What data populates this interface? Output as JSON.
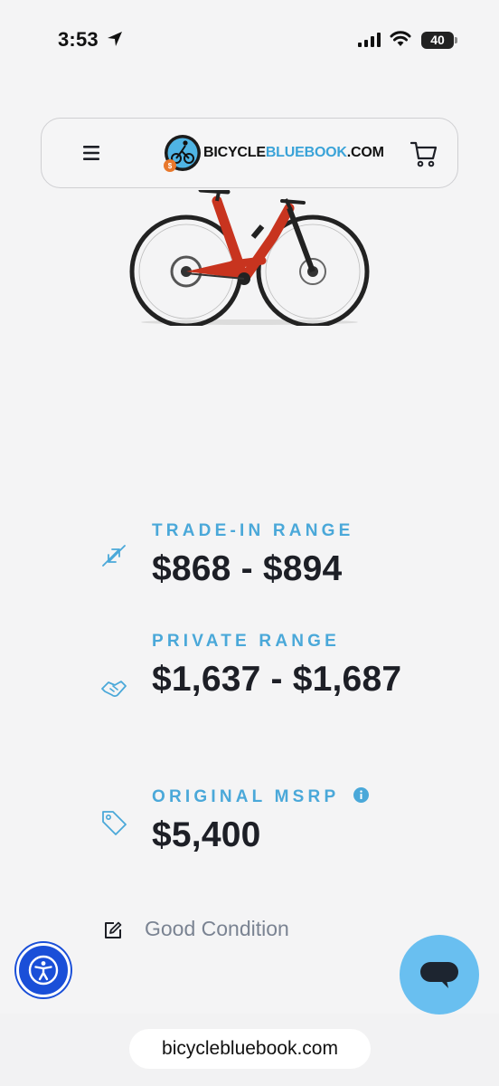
{
  "status_bar": {
    "time": "3:53",
    "battery": "40"
  },
  "header": {
    "logo_word_1": "BICYCLE",
    "logo_word_2": "BLUEBOOK",
    "logo_word_3": ".COM"
  },
  "ranges": [
    {
      "label": "TRADE-IN RANGE",
      "value": "$868 - $894",
      "icon": "trade-arrows-icon"
    },
    {
      "label": "PRIVATE RANGE",
      "value": "$1,637 - $1,687",
      "icon": "handshake-icon"
    },
    {
      "label": "ORIGINAL MSRP",
      "value": "$5,400",
      "icon": "price-tag-icon"
    }
  ],
  "condition": {
    "text": "Good Condition",
    "icon": "edit-icon"
  },
  "browser": {
    "url": "bicyclebluebook.com"
  },
  "colors": {
    "accent": "#4aa8d9",
    "value_text": "#1d1f26",
    "chat_button": "#69bff0",
    "accessibility_button": "#1a4fd8",
    "bike_frame": "#c8341f"
  }
}
